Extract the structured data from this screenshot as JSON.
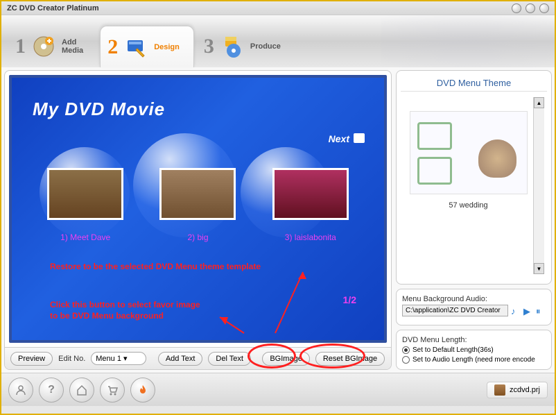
{
  "window": {
    "title": "ZC DVD Creator Platinum"
  },
  "steps": [
    {
      "num": "1",
      "label": "Add\nMedia"
    },
    {
      "num": "2",
      "label": "Design"
    },
    {
      "num": "3",
      "label": "Produce"
    }
  ],
  "dvd_menu": {
    "title": "My DVD Movie",
    "next": "Next",
    "page": "1/2",
    "thumbs": [
      {
        "label": "1) Meet Dave"
      },
      {
        "label": "2) big"
      },
      {
        "label": "3) laislabonita"
      }
    ]
  },
  "annotations": {
    "restore": "Restore to be the selected DVD Menu theme template",
    "bgimage": "Click this button to select favor image\nto be DVD Menu background"
  },
  "toolbar": {
    "preview": "Preview",
    "edit_no": "Edit No.",
    "menu_select": "Menu 1",
    "add_text": "Add Text",
    "del_text": "Del Text",
    "bgimage": "BGImage",
    "reset_bgimage": "Reset BGImage"
  },
  "theme_panel": {
    "header": "DVD Menu Theme",
    "caption": "57 wedding"
  },
  "settings": {
    "audio_label": "Menu Background Audio:",
    "audio_path": "C:\\application\\ZC DVD Creator",
    "length_label": "DVD Menu Length:",
    "opt_default": "Set to Default Length(36s)",
    "opt_audio": "Set to Audio Length (need more encode"
  },
  "footer": {
    "project": "zcdvd.prj"
  }
}
